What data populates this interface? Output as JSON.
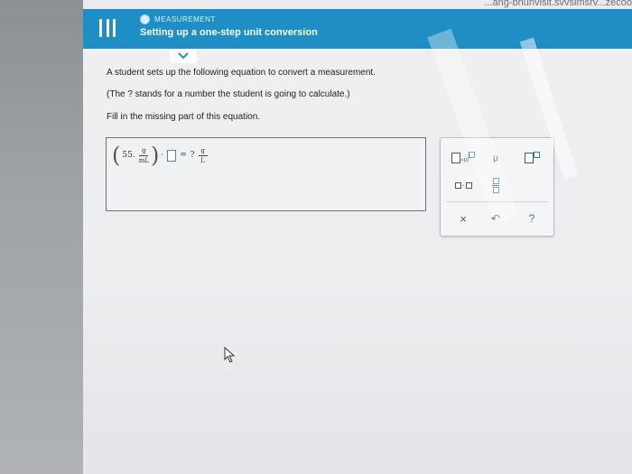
{
  "browser": {
    "tab_text": "...ang-bnunvisit.svvsimsrv...zecoo"
  },
  "header": {
    "topic": "MEASUREMENT",
    "title": "Setting up a one-step unit conversion"
  },
  "question": {
    "line1": "A student sets up the following equation to convert a measurement.",
    "line2": "(The ? stands for a number the student is going to calculate.)",
    "line3": "Fill in the missing part of this equation."
  },
  "equation": {
    "coefficient": "55.",
    "fraction_num": "g",
    "fraction_den": "mL",
    "operator": "·",
    "equals": "=",
    "unknown": "?",
    "result_num": "g",
    "result_den": "L"
  },
  "keypad": {
    "exponent_ten": "×10",
    "mu": "μ",
    "dot": "·",
    "clear": "×",
    "undo": "↶",
    "help": "?"
  },
  "colors": {
    "header": "#1f8ec4",
    "accent_blue": "#2f7ec0"
  }
}
